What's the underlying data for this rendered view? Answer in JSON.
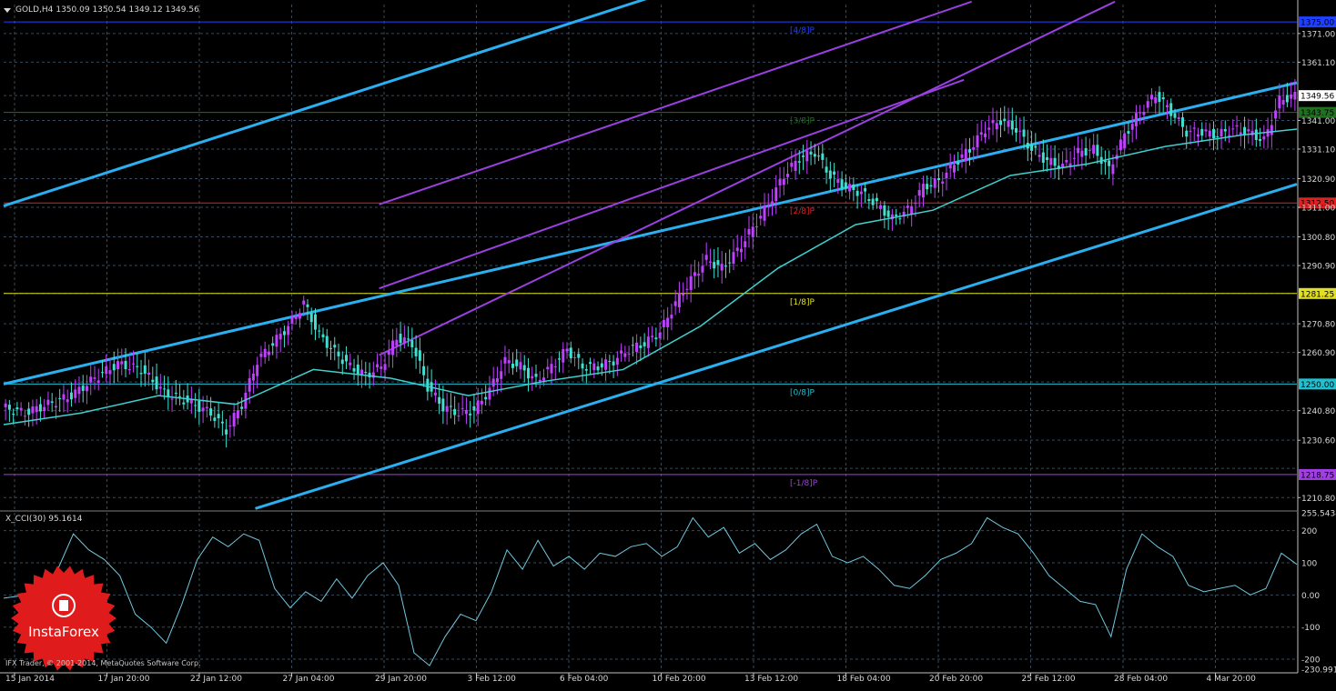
{
  "header": {
    "symbol": "GOLD,H4",
    "ohlc": "1350.09 1350.54 1349.12 1349.56"
  },
  "indicator": {
    "title": "X_CCI(30) 95.1614"
  },
  "footer": {
    "copyright": "IFX Trader, © 2001-2014, MetaQuotes Software Corp."
  },
  "logo": {
    "text": "InstaForex",
    "color": "#e01b1b"
  },
  "colors": {
    "background": "#000000",
    "grid": "#3a4a5a",
    "bull_candle": "#c040ff",
    "bear_candle": "#40e0d0",
    "ma_line": "#40d0d0",
    "channel_blue": "#2ab0f0",
    "channel_purple": "#9a40e0",
    "cci_line": "#70c8e0"
  },
  "chart_data": [
    {
      "type": "candlestick",
      "symbol": "GOLD",
      "timeframe": "H4",
      "ylim": [
        1206.8,
        1381.0
      ],
      "y_ticks": [
        1210.8,
        1220.9,
        1230.6,
        1240.8,
        1250.7,
        1260.9,
        1270.8,
        1281.25,
        1290.9,
        1300.8,
        1311.0,
        1320.9,
        1331.1,
        1341.0,
        1349.56,
        1361.1,
        1371.0
      ],
      "y_tick_labels": [
        "1210.80",
        "",
        "1230.60",
        "1240.80",
        "1250.00",
        "1260.90",
        "1270.80",
        "1281.25",
        "1290.90",
        "1300.80",
        "1311.00",
        "1320.90",
        "1331.10",
        "1341.00",
        "1349.56",
        "1361.10",
        "1371.00"
      ],
      "x_labels": [
        "15 Jan 2014",
        "17 Jan 20:00",
        "22 Jan 12:00",
        "27 Jan 04:00",
        "29 Jan 20:00",
        "3 Feb 12:00",
        "6 Feb 04:00",
        "10 Feb 20:00",
        "13 Feb 12:00",
        "18 Feb 04:00",
        "20 Feb 20:00",
        "25 Feb 12:00",
        "28 Feb 04:00",
        "4 Mar 20:00"
      ],
      "price_path": [
        [
          0,
          1242
        ],
        [
          6,
          1240
        ],
        [
          12,
          1243
        ],
        [
          18,
          1246
        ],
        [
          24,
          1252
        ],
        [
          30,
          1257
        ],
        [
          36,
          1255
        ],
        [
          42,
          1247
        ],
        [
          48,
          1244
        ],
        [
          54,
          1240
        ],
        [
          58,
          1234
        ],
        [
          62,
          1243
        ],
        [
          66,
          1258
        ],
        [
          70,
          1264
        ],
        [
          74,
          1270
        ],
        [
          78,
          1278
        ],
        [
          82,
          1267
        ],
        [
          86,
          1261
        ],
        [
          90,
          1256
        ],
        [
          94,
          1253
        ],
        [
          98,
          1256
        ],
        [
          102,
          1266
        ],
        [
          106,
          1264
        ],
        [
          110,
          1249
        ],
        [
          114,
          1242
        ],
        [
          118,
          1240
        ],
        [
          122,
          1241
        ],
        [
          126,
          1248
        ],
        [
          130,
          1258
        ],
        [
          134,
          1256
        ],
        [
          138,
          1251
        ],
        [
          142,
          1256
        ],
        [
          146,
          1262
        ],
        [
          150,
          1256
        ],
        [
          154,
          1256
        ],
        [
          158,
          1258
        ],
        [
          162,
          1262
        ],
        [
          166,
          1264
        ],
        [
          170,
          1268
        ],
        [
          174,
          1278
        ],
        [
          178,
          1286
        ],
        [
          182,
          1293
        ],
        [
          186,
          1290
        ],
        [
          190,
          1296
        ],
        [
          194,
          1304
        ],
        [
          198,
          1312
        ],
        [
          202,
          1322
        ],
        [
          206,
          1328
        ],
        [
          210,
          1330
        ],
        [
          214,
          1322
        ],
        [
          218,
          1318
        ],
        [
          222,
          1316
        ],
        [
          226,
          1312
        ],
        [
          230,
          1307
        ],
        [
          234,
          1310
        ],
        [
          238,
          1318
        ],
        [
          242,
          1320
        ],
        [
          246,
          1326
        ],
        [
          250,
          1331
        ],
        [
          254,
          1338
        ],
        [
          258,
          1341
        ],
        [
          262,
          1338
        ],
        [
          266,
          1331
        ],
        [
          270,
          1327
        ],
        [
          274,
          1325
        ],
        [
          278,
          1330
        ],
        [
          282,
          1331
        ],
        [
          286,
          1324
        ],
        [
          290,
          1336
        ],
        [
          294,
          1344
        ],
        [
          298,
          1350
        ],
        [
          302,
          1344
        ],
        [
          306,
          1337
        ],
        [
          310,
          1337
        ],
        [
          314,
          1336
        ],
        [
          318,
          1338
        ],
        [
          322,
          1337
        ],
        [
          326,
          1334
        ],
        [
          330,
          1348
        ],
        [
          334,
          1349.56
        ]
      ],
      "moving_average_path": [
        [
          0,
          1236
        ],
        [
          20,
          1240
        ],
        [
          40,
          1246
        ],
        [
          60,
          1243
        ],
        [
          80,
          1255
        ],
        [
          100,
          1252
        ],
        [
          120,
          1246
        ],
        [
          140,
          1251
        ],
        [
          160,
          1255
        ],
        [
          180,
          1270
        ],
        [
          200,
          1290
        ],
        [
          220,
          1305
        ],
        [
          240,
          1310
        ],
        [
          260,
          1322
        ],
        [
          280,
          1326
        ],
        [
          300,
          1332
        ],
        [
          320,
          1336
        ],
        [
          334,
          1338
        ]
      ],
      "horizontal_levels": [
        {
          "value": 1375.0,
          "label": "[4/8]P",
          "price_label": "1375.00",
          "color": "#2040ff"
        },
        {
          "value": 1343.75,
          "label": "[3/8]P",
          "price_label": "1343.75",
          "color": "#207020"
        },
        {
          "value": 1312.5,
          "label": "[2/8]P",
          "price_label": "1312.50",
          "color": "#e02020"
        },
        {
          "value": 1281.25,
          "label": "[1/8]P",
          "price_label": "1281.25",
          "color": "#e0e020"
        },
        {
          "value": 1250.0,
          "label": "[0/8]P",
          "price_label": "1250.00",
          "color": "#20c0d0"
        },
        {
          "value": 1218.75,
          "label": "[-1/8]P",
          "price_label": "1218.75",
          "color": "#a040e0"
        }
      ],
      "current_price": 1349.56
    },
    {
      "type": "line",
      "name": "X_CCI(30)",
      "ylim": [
        -230.9914,
        255.5434
      ],
      "y_ticks": [
        255.5434,
        200,
        100,
        0,
        -100,
        -200,
        -230.9914
      ],
      "y_tick_labels": [
        "255.5434",
        "200",
        "100",
        "0.00",
        "-100",
        "-200",
        "-230.9914"
      ],
      "values": [
        [
          0,
          -10
        ],
        [
          6,
          0
        ],
        [
          10,
          20
        ],
        [
          14,
          80
        ],
        [
          18,
          190
        ],
        [
          22,
          140
        ],
        [
          26,
          110
        ],
        [
          30,
          60
        ],
        [
          34,
          -60
        ],
        [
          38,
          -100
        ],
        [
          42,
          -150
        ],
        [
          46,
          -30
        ],
        [
          50,
          110
        ],
        [
          54,
          180
        ],
        [
          58,
          150
        ],
        [
          62,
          190
        ],
        [
          66,
          170
        ],
        [
          70,
          20
        ],
        [
          74,
          -40
        ],
        [
          78,
          10
        ],
        [
          82,
          -20
        ],
        [
          86,
          50
        ],
        [
          90,
          -10
        ],
        [
          94,
          60
        ],
        [
          98,
          100
        ],
        [
          102,
          30
        ],
        [
          106,
          -180
        ],
        [
          110,
          -220
        ],
        [
          114,
          -130
        ],
        [
          118,
          -60
        ],
        [
          122,
          -80
        ],
        [
          126,
          10
        ],
        [
          130,
          140
        ],
        [
          134,
          80
        ],
        [
          138,
          170
        ],
        [
          142,
          90
        ],
        [
          146,
          120
        ],
        [
          150,
          80
        ],
        [
          154,
          130
        ],
        [
          158,
          120
        ],
        [
          162,
          150
        ],
        [
          166,
          160
        ],
        [
          170,
          120
        ],
        [
          174,
          150
        ],
        [
          178,
          240
        ],
        [
          182,
          180
        ],
        [
          186,
          210
        ],
        [
          190,
          130
        ],
        [
          194,
          160
        ],
        [
          198,
          110
        ],
        [
          202,
          140
        ],
        [
          206,
          190
        ],
        [
          210,
          220
        ],
        [
          214,
          120
        ],
        [
          218,
          100
        ],
        [
          222,
          120
        ],
        [
          226,
          80
        ],
        [
          230,
          30
        ],
        [
          234,
          20
        ],
        [
          238,
          60
        ],
        [
          242,
          110
        ],
        [
          246,
          130
        ],
        [
          250,
          160
        ],
        [
          254,
          240
        ],
        [
          258,
          210
        ],
        [
          262,
          190
        ],
        [
          266,
          130
        ],
        [
          270,
          60
        ],
        [
          274,
          20
        ],
        [
          278,
          -20
        ],
        [
          282,
          -30
        ],
        [
          286,
          -130
        ],
        [
          290,
          80
        ],
        [
          294,
          190
        ],
        [
          298,
          150
        ],
        [
          302,
          120
        ],
        [
          306,
          30
        ],
        [
          310,
          10
        ],
        [
          314,
          20
        ],
        [
          318,
          30
        ],
        [
          322,
          0
        ],
        [
          326,
          20
        ],
        [
          330,
          130
        ],
        [
          334,
          95.1614
        ]
      ]
    }
  ]
}
